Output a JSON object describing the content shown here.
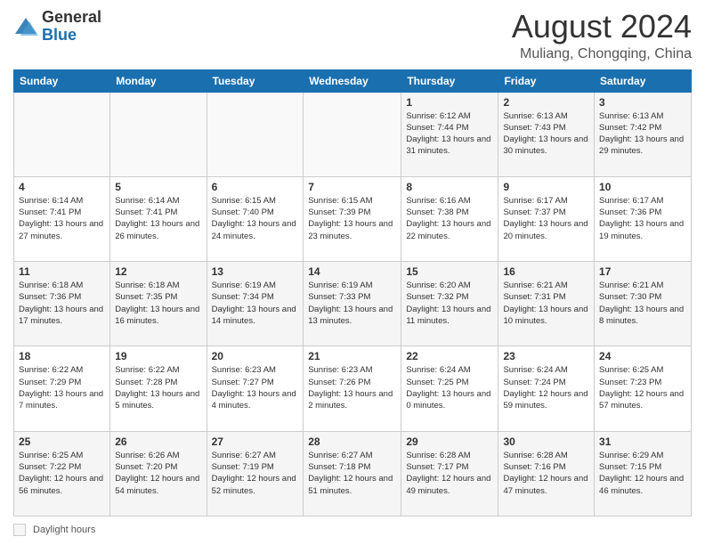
{
  "header": {
    "logo": {
      "line1": "General",
      "line2": "Blue"
    },
    "title": "August 2024",
    "subtitle": "Muliang, Chongqing, China"
  },
  "days_of_week": [
    "Sunday",
    "Monday",
    "Tuesday",
    "Wednesday",
    "Thursday",
    "Friday",
    "Saturday"
  ],
  "weeks": [
    [
      {
        "day": "",
        "info": ""
      },
      {
        "day": "",
        "info": ""
      },
      {
        "day": "",
        "info": ""
      },
      {
        "day": "",
        "info": ""
      },
      {
        "day": "1",
        "info": "Sunrise: 6:12 AM\nSunset: 7:44 PM\nDaylight: 13 hours and 31 minutes."
      },
      {
        "day": "2",
        "info": "Sunrise: 6:13 AM\nSunset: 7:43 PM\nDaylight: 13 hours and 30 minutes."
      },
      {
        "day": "3",
        "info": "Sunrise: 6:13 AM\nSunset: 7:42 PM\nDaylight: 13 hours and 29 minutes."
      }
    ],
    [
      {
        "day": "4",
        "info": "Sunrise: 6:14 AM\nSunset: 7:41 PM\nDaylight: 13 hours and 27 minutes."
      },
      {
        "day": "5",
        "info": "Sunrise: 6:14 AM\nSunset: 7:41 PM\nDaylight: 13 hours and 26 minutes."
      },
      {
        "day": "6",
        "info": "Sunrise: 6:15 AM\nSunset: 7:40 PM\nDaylight: 13 hours and 24 minutes."
      },
      {
        "day": "7",
        "info": "Sunrise: 6:15 AM\nSunset: 7:39 PM\nDaylight: 13 hours and 23 minutes."
      },
      {
        "day": "8",
        "info": "Sunrise: 6:16 AM\nSunset: 7:38 PM\nDaylight: 13 hours and 22 minutes."
      },
      {
        "day": "9",
        "info": "Sunrise: 6:17 AM\nSunset: 7:37 PM\nDaylight: 13 hours and 20 minutes."
      },
      {
        "day": "10",
        "info": "Sunrise: 6:17 AM\nSunset: 7:36 PM\nDaylight: 13 hours and 19 minutes."
      }
    ],
    [
      {
        "day": "11",
        "info": "Sunrise: 6:18 AM\nSunset: 7:36 PM\nDaylight: 13 hours and 17 minutes."
      },
      {
        "day": "12",
        "info": "Sunrise: 6:18 AM\nSunset: 7:35 PM\nDaylight: 13 hours and 16 minutes."
      },
      {
        "day": "13",
        "info": "Sunrise: 6:19 AM\nSunset: 7:34 PM\nDaylight: 13 hours and 14 minutes."
      },
      {
        "day": "14",
        "info": "Sunrise: 6:19 AM\nSunset: 7:33 PM\nDaylight: 13 hours and 13 minutes."
      },
      {
        "day": "15",
        "info": "Sunrise: 6:20 AM\nSunset: 7:32 PM\nDaylight: 13 hours and 11 minutes."
      },
      {
        "day": "16",
        "info": "Sunrise: 6:21 AM\nSunset: 7:31 PM\nDaylight: 13 hours and 10 minutes."
      },
      {
        "day": "17",
        "info": "Sunrise: 6:21 AM\nSunset: 7:30 PM\nDaylight: 13 hours and 8 minutes."
      }
    ],
    [
      {
        "day": "18",
        "info": "Sunrise: 6:22 AM\nSunset: 7:29 PM\nDaylight: 13 hours and 7 minutes."
      },
      {
        "day": "19",
        "info": "Sunrise: 6:22 AM\nSunset: 7:28 PM\nDaylight: 13 hours and 5 minutes."
      },
      {
        "day": "20",
        "info": "Sunrise: 6:23 AM\nSunset: 7:27 PM\nDaylight: 13 hours and 4 minutes."
      },
      {
        "day": "21",
        "info": "Sunrise: 6:23 AM\nSunset: 7:26 PM\nDaylight: 13 hours and 2 minutes."
      },
      {
        "day": "22",
        "info": "Sunrise: 6:24 AM\nSunset: 7:25 PM\nDaylight: 13 hours and 0 minutes."
      },
      {
        "day": "23",
        "info": "Sunrise: 6:24 AM\nSunset: 7:24 PM\nDaylight: 12 hours and 59 minutes."
      },
      {
        "day": "24",
        "info": "Sunrise: 6:25 AM\nSunset: 7:23 PM\nDaylight: 12 hours and 57 minutes."
      }
    ],
    [
      {
        "day": "25",
        "info": "Sunrise: 6:25 AM\nSunset: 7:22 PM\nDaylight: 12 hours and 56 minutes."
      },
      {
        "day": "26",
        "info": "Sunrise: 6:26 AM\nSunset: 7:20 PM\nDaylight: 12 hours and 54 minutes."
      },
      {
        "day": "27",
        "info": "Sunrise: 6:27 AM\nSunset: 7:19 PM\nDaylight: 12 hours and 52 minutes."
      },
      {
        "day": "28",
        "info": "Sunrise: 6:27 AM\nSunset: 7:18 PM\nDaylight: 12 hours and 51 minutes."
      },
      {
        "day": "29",
        "info": "Sunrise: 6:28 AM\nSunset: 7:17 PM\nDaylight: 12 hours and 49 minutes."
      },
      {
        "day": "30",
        "info": "Sunrise: 6:28 AM\nSunset: 7:16 PM\nDaylight: 12 hours and 47 minutes."
      },
      {
        "day": "31",
        "info": "Sunrise: 6:29 AM\nSunset: 7:15 PM\nDaylight: 12 hours and 46 minutes."
      }
    ]
  ],
  "footer": {
    "daylight_label": "Daylight hours"
  }
}
